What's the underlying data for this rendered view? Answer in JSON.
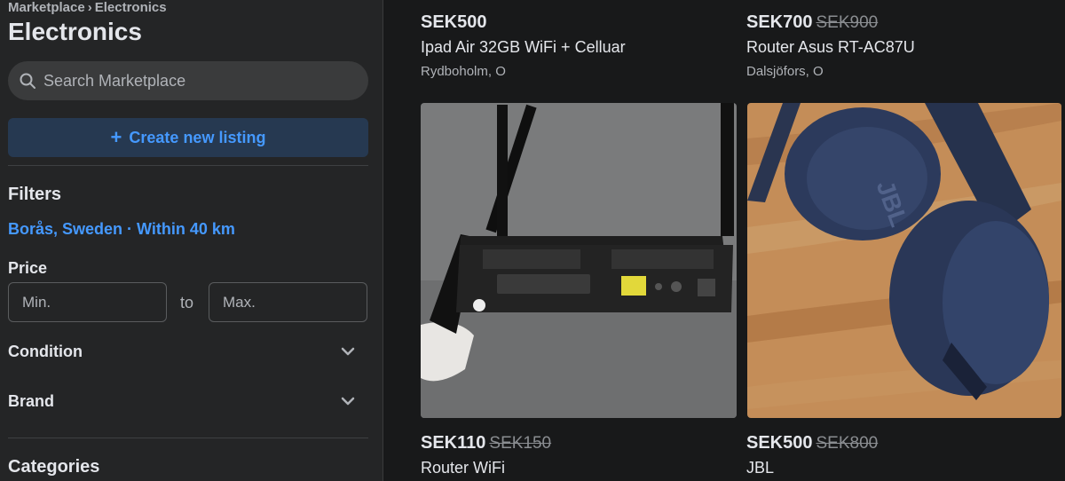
{
  "breadcrumb": {
    "root": "Marketplace",
    "separator": "›",
    "current": "Electronics"
  },
  "page_title": "Electronics",
  "search": {
    "placeholder": "Search Marketplace",
    "value": ""
  },
  "create_listing": {
    "icon": "plus-icon",
    "label": "Create new listing"
  },
  "filters": {
    "title": "Filters",
    "location": "Borås, Sweden · Within 40 km",
    "price": {
      "label": "Price",
      "min_placeholder": "Min.",
      "max_placeholder": "Max.",
      "separator": "to"
    },
    "accordions": [
      {
        "label": "Condition",
        "icon": "chevron-down-icon"
      },
      {
        "label": "Brand",
        "icon": "chevron-down-icon"
      }
    ]
  },
  "categories_title": "Categories",
  "listings": [
    {
      "price": "SEK500",
      "old_price": "",
      "title": "Ipad Air 32GB WiFi + Celluar",
      "location": "Rydboholm, O"
    },
    {
      "price": "SEK700",
      "old_price": "SEK900",
      "title": "Router Asus RT-AC87U",
      "location": "Dalsjöfors, O"
    },
    {
      "price": "SEK110",
      "old_price": "SEK150",
      "title": "Router WiFi",
      "location": ""
    },
    {
      "price": "SEK500",
      "old_price": "SEK800",
      "title": "JBL",
      "location": ""
    }
  ],
  "colors": {
    "background": "#18191a",
    "sidebar": "#242526",
    "accent": "#4599ff",
    "button_bg": "#263951"
  }
}
